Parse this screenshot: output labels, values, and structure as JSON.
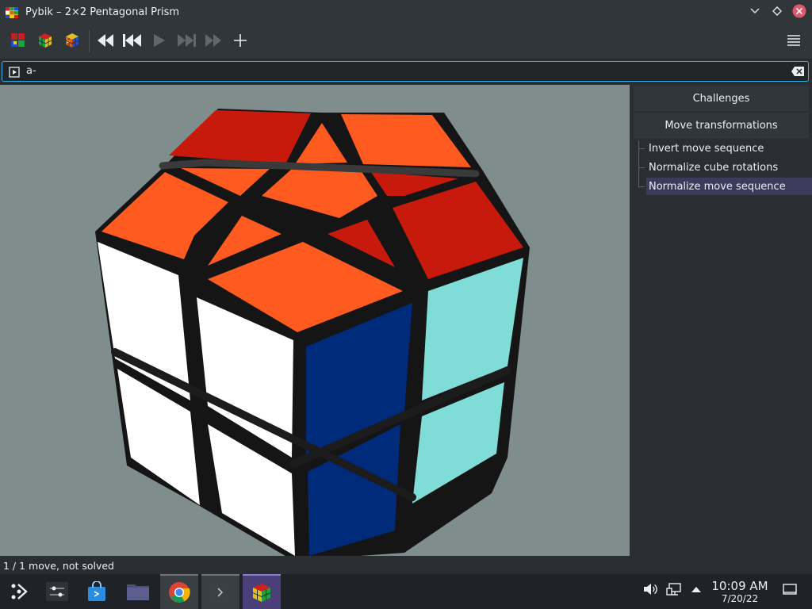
{
  "window": {
    "title": "Pybik – 2×2 Pentagonal Prism"
  },
  "toolbar": {
    "buttons": [
      "new-game-icon",
      "random-game-icon",
      "select-model-icon",
      "rewind-icon",
      "previous-icon",
      "play-icon",
      "next-icon",
      "forward-icon",
      "add-mark-icon"
    ],
    "menu_icon": "hamburger-menu-icon"
  },
  "move_entry": {
    "value": "a-"
  },
  "sidebar": {
    "buttons": [
      "Challenges",
      "Move transformations"
    ],
    "items": [
      "Invert move sequence",
      "Normalize cube rotations",
      "Normalize move sequence"
    ],
    "selected_index": 2
  },
  "status": {
    "text": "1 / 1 move, not solved"
  },
  "colors": {
    "accent": "#3daee9",
    "selection": "#3e3a5c",
    "face_red": "#c81a0c",
    "face_orange": "#ff5a1f",
    "face_white": "#ffffff",
    "face_blue": "#002a7a",
    "face_cyan": "#7fdcd6",
    "viewport_bg": "#7f8d8c"
  },
  "taskbar": {
    "apps": [
      "application-launcher-icon",
      "system-settings-icon",
      "discover-store-icon",
      "file-manager-icon",
      "chrome-browser-icon",
      "terminal-icon",
      "pybik-app-icon"
    ],
    "clock_time": "10:09 AM",
    "clock_date": "7/20/22"
  }
}
